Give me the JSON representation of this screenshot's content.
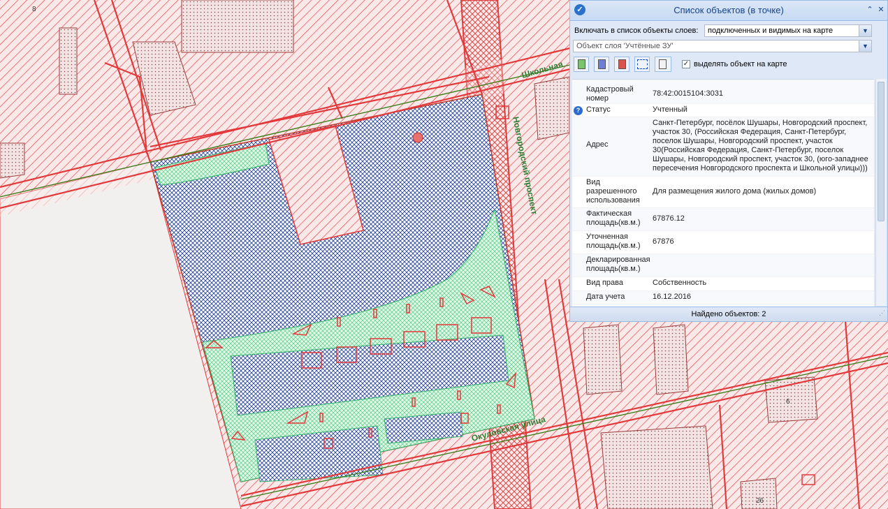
{
  "map": {
    "streets": {
      "school": "Школьная",
      "novgorod": "Новгородский проспект",
      "okulov": "Окуловская улица"
    },
    "house_numbers": [
      "8",
      "6",
      "26"
    ]
  },
  "panel": {
    "title": "Список объектов (в точке)",
    "layers_label": "Включать в список объекты слоев:",
    "layers_value": "подключенных и видимых на карте",
    "layer_object_value": "Объект слоя 'Учтённые ЗУ'",
    "highlight_label": "выделять объект на карте",
    "highlight_checked": true,
    "toolbar_icons": [
      "excel-export-icon",
      "word-export-icon",
      "pdf-export-icon",
      "select-extent-icon",
      "report-icon"
    ],
    "properties": [
      {
        "key": "Кадастровый номер",
        "value": "78:42:0015104:3031"
      },
      {
        "key": "Статус",
        "value": "Учтенный"
      },
      {
        "key": "Адрес",
        "value": "Санкт-Петербург, посёлок Шушары, Новгородский проспект, участок 30, (Российская Федерация, Санкт-Петербург, поселок Шушары, Новгородский проспект, участок 30(Российская Федерация, Санкт-Петербург, поселок Шушары, Новгородский проспект, участок 30, (юго-западнее пересечения Новгородского проспекта и Школьной улицы)))"
      },
      {
        "key": "Вид разрешенного использования",
        "value": "Для размещения жилого дома (жилых домов)"
      },
      {
        "key": "Фактическая площадь(кв.м.)",
        "value": "67876.12"
      },
      {
        "key": "Уточненная площадь(кв.м.)",
        "value": "67876"
      },
      {
        "key": "Декларированная площадь(кв.м.)",
        "value": ""
      },
      {
        "key": "Вид права",
        "value": "Собственность"
      },
      {
        "key": "Дата учета",
        "value": "16.12.2016"
      }
    ],
    "status_text": "Найдено объектов: 2"
  }
}
